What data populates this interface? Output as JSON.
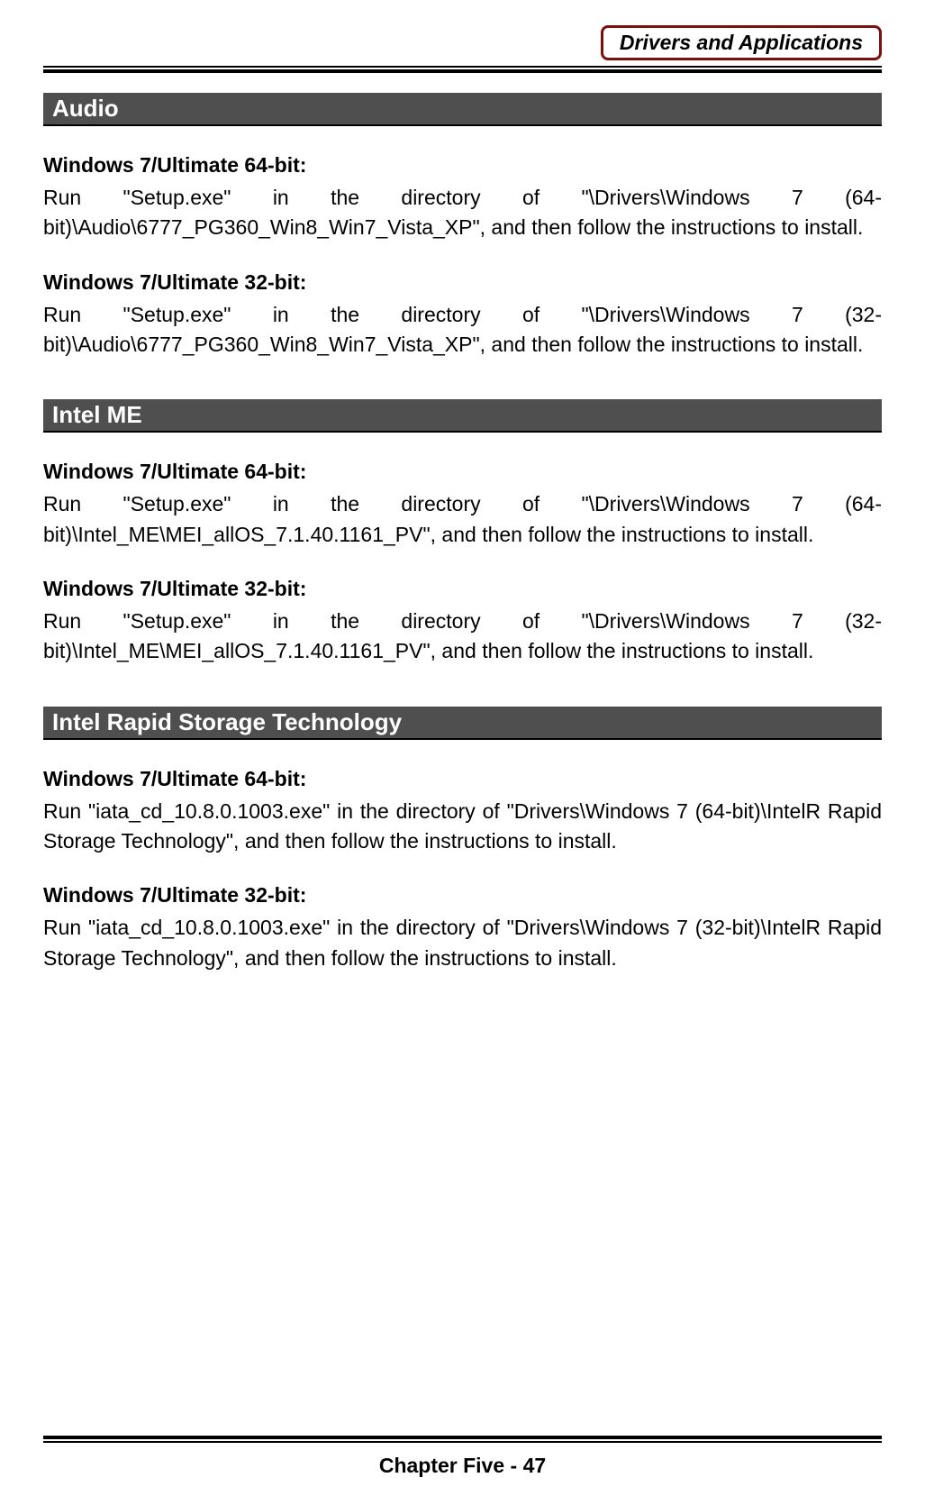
{
  "header": {
    "title": "Drivers and Applications"
  },
  "sections": [
    {
      "title": "Audio",
      "blocks": [
        {
          "heading": "Windows 7/Ultimate 64-bit:",
          "text": "Run \"Setup.exe\" in the directory of \"\\Drivers\\Windows 7 (64-bit)\\Audio\\6777_PG360_Win8_Win7_Vista_XP\", and then follow the instructions to install."
        },
        {
          "heading": "Windows 7/Ultimate 32-bit:",
          "text": "Run \"Setup.exe\" in the directory of \"\\Drivers\\Windows 7 (32-bit)\\Audio\\6777_PG360_Win8_Win7_Vista_XP\", and then follow the instructions to install."
        }
      ]
    },
    {
      "title": "Intel ME",
      "blocks": [
        {
          "heading": "Windows 7/Ultimate 64-bit:",
          "text": "Run \"Setup.exe\" in the directory of \"\\Drivers\\Windows 7 (64-bit)\\Intel_ME\\MEI_allOS_7.1.40.1161_PV\", and then follow the instructions to install."
        },
        {
          "heading": "Windows 7/Ultimate 32-bit:",
          "text": "Run \"Setup.exe\" in the directory of \"\\Drivers\\Windows 7 (32-bit)\\Intel_ME\\MEI_allOS_7.1.40.1161_PV\", and then follow the instructions to install."
        }
      ]
    },
    {
      "title": "Intel Rapid Storage Technology",
      "blocks": [
        {
          "heading": "Windows 7/Ultimate 64-bit:",
          "text": "Run \"iata_cd_10.8.0.1003.exe\" in the directory of \"Drivers\\Windows 7 (64-bit)\\IntelR Rapid Storage Technology\", and then follow the instructions to install."
        },
        {
          "heading": "Windows 7/Ultimate 32-bit:",
          "text": "Run \"iata_cd_10.8.0.1003.exe\" in the directory of \"Drivers\\Windows 7 (32-bit)\\IntelR Rapid Storage Technology\", and then follow the instructions to install."
        }
      ]
    }
  ],
  "footer": {
    "label": "Chapter Five - 47"
  }
}
